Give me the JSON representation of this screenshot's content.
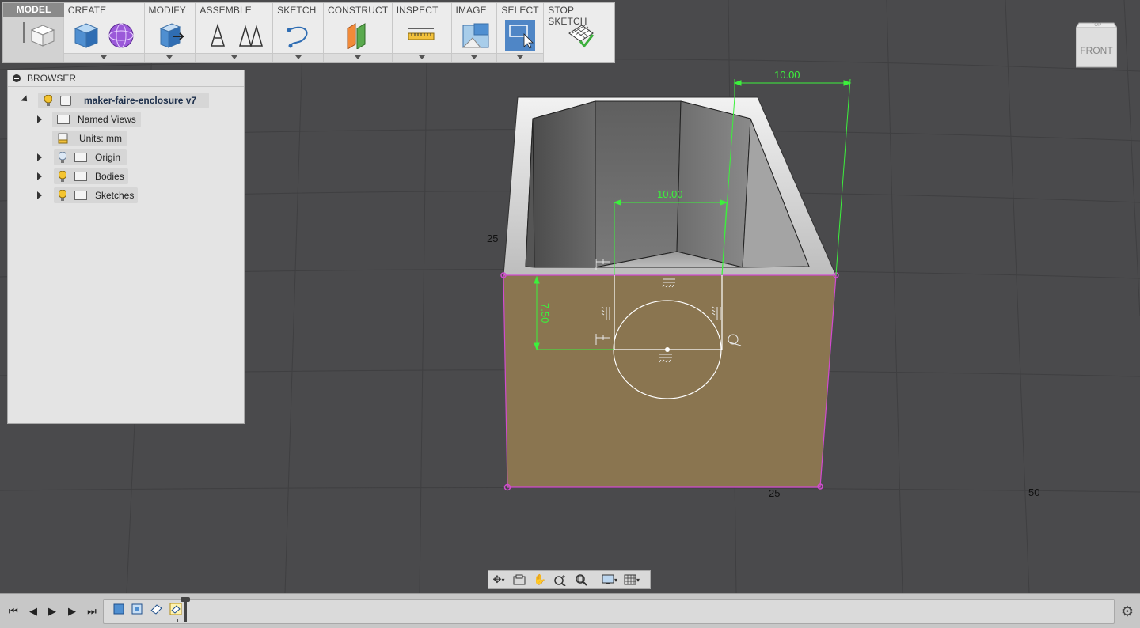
{
  "toolbar": {
    "model_label": "MODEL",
    "groups": [
      {
        "label": "CREATE",
        "icons": [
          "box-icon",
          "sphere-icon"
        ]
      },
      {
        "label": "MODIFY",
        "icons": [
          "press-pull-icon"
        ]
      },
      {
        "label": "ASSEMBLE",
        "icons": [
          "joint-icon",
          "as-built-joint-icon"
        ]
      },
      {
        "label": "SKETCH",
        "icons": [
          "sketch-curve-icon"
        ]
      },
      {
        "label": "CONSTRUCT",
        "icons": [
          "offset-plane-icon"
        ]
      },
      {
        "label": "INSPECT",
        "icons": [
          "measure-ruler-icon"
        ]
      },
      {
        "label": "IMAGE",
        "icons": [
          "render-image-icon"
        ]
      },
      {
        "label": "SELECT",
        "icons": [
          "select-window-icon"
        ]
      },
      {
        "label": "STOP SKETCH",
        "icons": [
          "stop-sketch-icon"
        ]
      }
    ]
  },
  "browser": {
    "title": "BROWSER",
    "root": "maker-faire-enclosure v7",
    "items": [
      "Named Views",
      "Units: mm",
      "Origin",
      "Bodies",
      "Sketches"
    ]
  },
  "viewcube": {
    "face": "FRONT",
    "top": "TOP"
  },
  "viewport": {
    "dimensions": [
      "10.00",
      "10.00",
      "7.50"
    ],
    "grid_labels": [
      "25",
      "25",
      "50"
    ]
  },
  "colors": {
    "background": "#4a4a4c",
    "sketch_face": "#8a7550",
    "dimension": "#3cf13c",
    "profile_edge": "#d14bd0",
    "select_active": "#4f86c6"
  },
  "navbar": {
    "icons": [
      "orbit-icon",
      "look-at-icon",
      "pan-icon",
      "zoom-icon",
      "fit-icon",
      "display-settings-icon",
      "grid-settings-icon"
    ]
  },
  "timeline": {
    "controls": [
      "first-icon",
      "previous-icon",
      "play-icon",
      "next-icon",
      "last-icon"
    ],
    "features": [
      "extrude-feature",
      "shell-feature",
      "sketch-feature",
      "active-sketch-feature"
    ]
  }
}
